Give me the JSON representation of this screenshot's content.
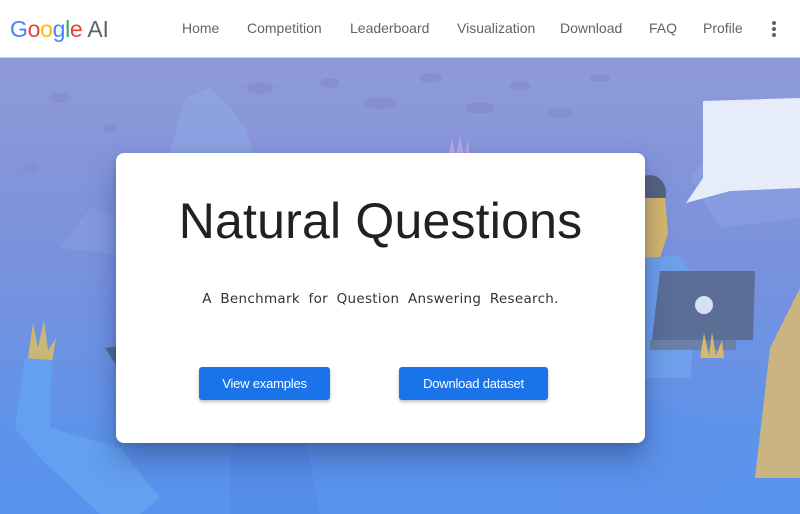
{
  "header": {
    "logo": {
      "letters": [
        "G",
        "o",
        "o",
        "g",
        "l",
        "e"
      ],
      "suffix": "AI"
    },
    "nav": [
      {
        "label": "Home"
      },
      {
        "label": "Competition"
      },
      {
        "label": "Leaderboard"
      },
      {
        "label": "Visualization"
      },
      {
        "label": "Download"
      },
      {
        "label": "FAQ"
      },
      {
        "label": "Profile"
      }
    ],
    "more_icon": "more-vert-icon"
  },
  "hero": {
    "title": "Natural Questions",
    "subtitle": "A Benchmark for Question Answering Research.",
    "buttons": {
      "view_examples": "View examples",
      "download_dataset": "Download dataset"
    },
    "illustration": "people-with-laptop-and-speech-bubble",
    "colors": {
      "button": "#1a73e8",
      "hero_top": "#8f9bd8",
      "hero_bottom": "#5893ee"
    }
  }
}
